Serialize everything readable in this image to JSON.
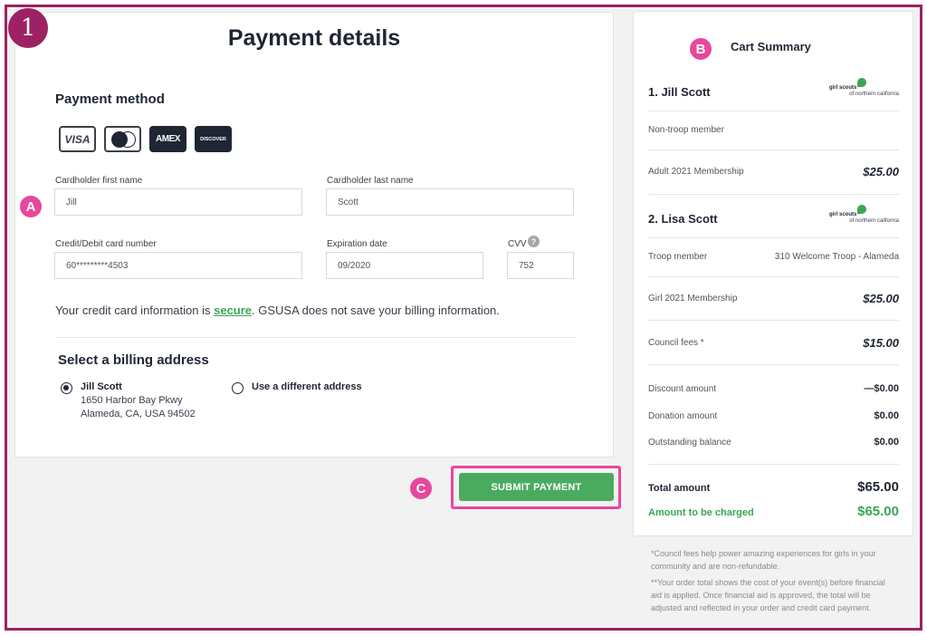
{
  "annotations": {
    "step": "1",
    "marker_a": "A",
    "marker_b": "B",
    "marker_c": "C"
  },
  "payment": {
    "title": "Payment details",
    "method_title": "Payment method",
    "card_brands": [
      {
        "name": "visa-icon",
        "label": "VISA"
      },
      {
        "name": "mastercard-icon",
        "label": ""
      },
      {
        "name": "amex-icon",
        "label": "AMEX"
      },
      {
        "name": "discover-icon",
        "label": "DISCOVER"
      }
    ],
    "fields": {
      "first_name": {
        "label": "Cardholder first name",
        "value": "Jill"
      },
      "last_name": {
        "label": "Cardholder last name",
        "value": "Scott"
      },
      "card_number": {
        "label": "Credit/Debit card number",
        "value": "60*********4503"
      },
      "expiration": {
        "label": "Expiration date",
        "value": "09/2020"
      },
      "cvv": {
        "label": "CVV",
        "value": "752",
        "help": "?"
      }
    },
    "secure_note": {
      "prefix": "Your credit card information is ",
      "link": "secure",
      "suffix": ". GSUSA does not save your billing information."
    },
    "billing": {
      "title": "Select a billing address",
      "options": [
        {
          "label": "Jill Scott",
          "line1": "1650 Harbor Bay Pkwy",
          "line2": "Alameda, CA, USA 94502",
          "selected": true
        },
        {
          "label": "Use a different address",
          "selected": false
        }
      ]
    },
    "submit_label": "SUBMIT PAYMENT"
  },
  "cart": {
    "title": "Cart Summary",
    "logo": {
      "line1": "girl scouts",
      "line2": "of northern california"
    },
    "members": [
      {
        "name": "1. Jill Scott",
        "type": "Non-troop member",
        "troop": "",
        "items": [
          {
            "label": "Adult 2021 Membership",
            "price": "$25.00"
          }
        ]
      },
      {
        "name": "2. Lisa Scott",
        "type": "Troop member",
        "troop": "310 Welcome Troop - Alameda",
        "items": [
          {
            "label": "Girl 2021 Membership",
            "price": "$25.00"
          },
          {
            "label": "Council fees *",
            "price": "$15.00"
          }
        ]
      }
    ],
    "adjustments": [
      {
        "label": "Discount amount",
        "value": "—$0.00"
      },
      {
        "label": "Donation amount",
        "value": "$0.00"
      },
      {
        "label": "Outstanding balance",
        "value": "$0.00"
      }
    ],
    "total": {
      "label": "Total amount",
      "value": "$65.00"
    },
    "charged": {
      "label": "Amount to be charged",
      "value": "$65.00"
    },
    "footnotes": [
      "*Council fees help power amazing experiences for girls in your community and are non-refundable.",
      "**Your order total shows the cost of your event(s) before financial aid is applied. Once financial aid is approved, the total will be adjusted and reflected in your order and credit card payment."
    ]
  },
  "colors": {
    "frame": "#9d2263",
    "marker": "#e7479c",
    "accent_green": "#3aa655",
    "button_green": "#4aab60",
    "text_dark": "#1f2533"
  }
}
